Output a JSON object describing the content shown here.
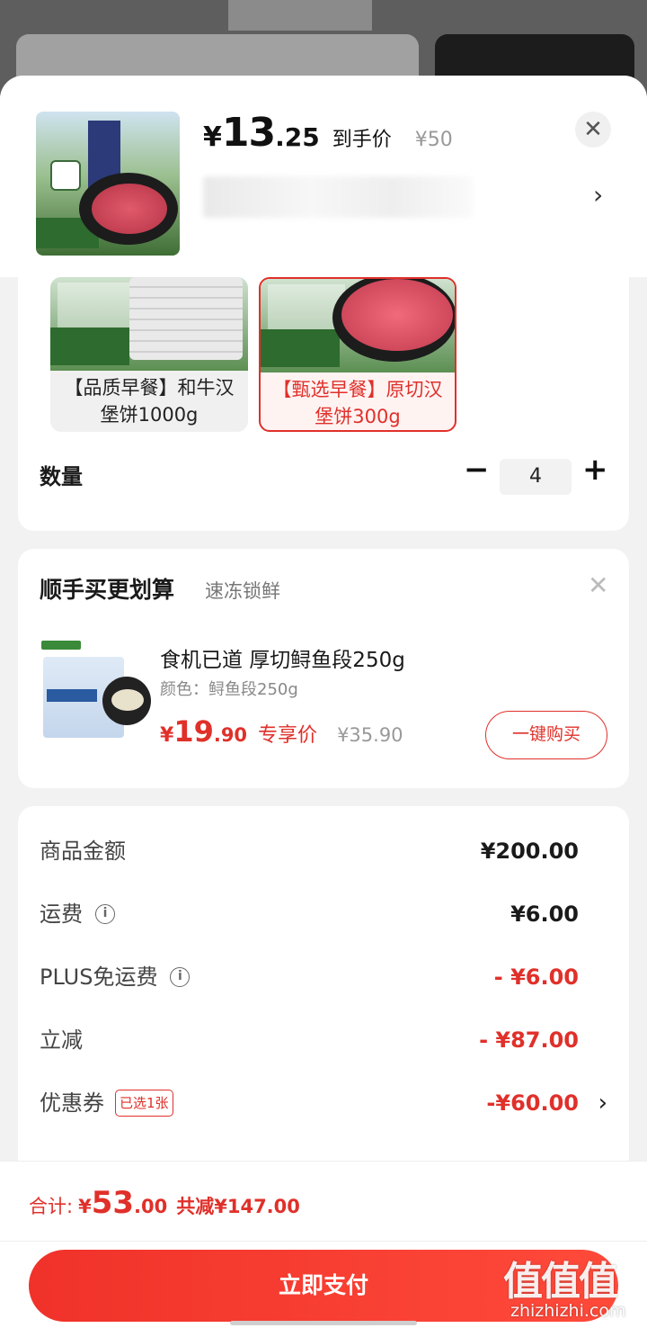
{
  "header": {
    "price_symbol": "¥",
    "price_integer": "13",
    "price_decimal": ".25",
    "price_label": "到手价",
    "original_price": "¥50",
    "close_glyph": "✕",
    "chevron_glyph": "›"
  },
  "spec": {
    "options": [
      {
        "label": "【品质早餐】和牛汉堡饼1000g",
        "selected": false
      },
      {
        "label": "【甄选早餐】原切汉堡饼300g",
        "selected": true
      }
    ],
    "quantity_label": "数量",
    "quantity_value": "4",
    "minus_glyph": "−",
    "plus_glyph": "+"
  },
  "addon": {
    "title": "顺手买更划算",
    "subtitle": "速冻锁鲜",
    "close_glyph": "✕",
    "product_name": "食机已道 厚切鲟鱼段250g",
    "color_text": "颜色：鲟鱼段250g",
    "price_symbol": "¥",
    "price_integer": "19",
    "price_decimal": ".90",
    "price_tag": "专享价",
    "original_price": "¥35.90",
    "buy_label": "一键购买"
  },
  "summary": {
    "rows": [
      {
        "label": "商品金额",
        "value": "¥200.00"
      },
      {
        "label": "运费",
        "value": "¥6.00"
      },
      {
        "label": "PLUS免运费",
        "value": "- ¥6.00"
      },
      {
        "label": "立减",
        "value": "- ¥87.00"
      },
      {
        "label": "优惠券",
        "badge": "已选1张",
        "value": "-¥60.00"
      }
    ],
    "info_glyph": "i",
    "chevron_glyph": "›"
  },
  "footer": {
    "total_label": "合计:",
    "total_symbol": "¥",
    "total_integer": "53",
    "total_decimal": ".00",
    "total_saved": "共减¥147.00",
    "pay_label": "立即支付"
  },
  "watermark": {
    "logo_text": "值值值",
    "site": "zhizhizhi.com"
  },
  "colors": {
    "accent": "#e0302a",
    "pay_button": "#f0322a"
  }
}
